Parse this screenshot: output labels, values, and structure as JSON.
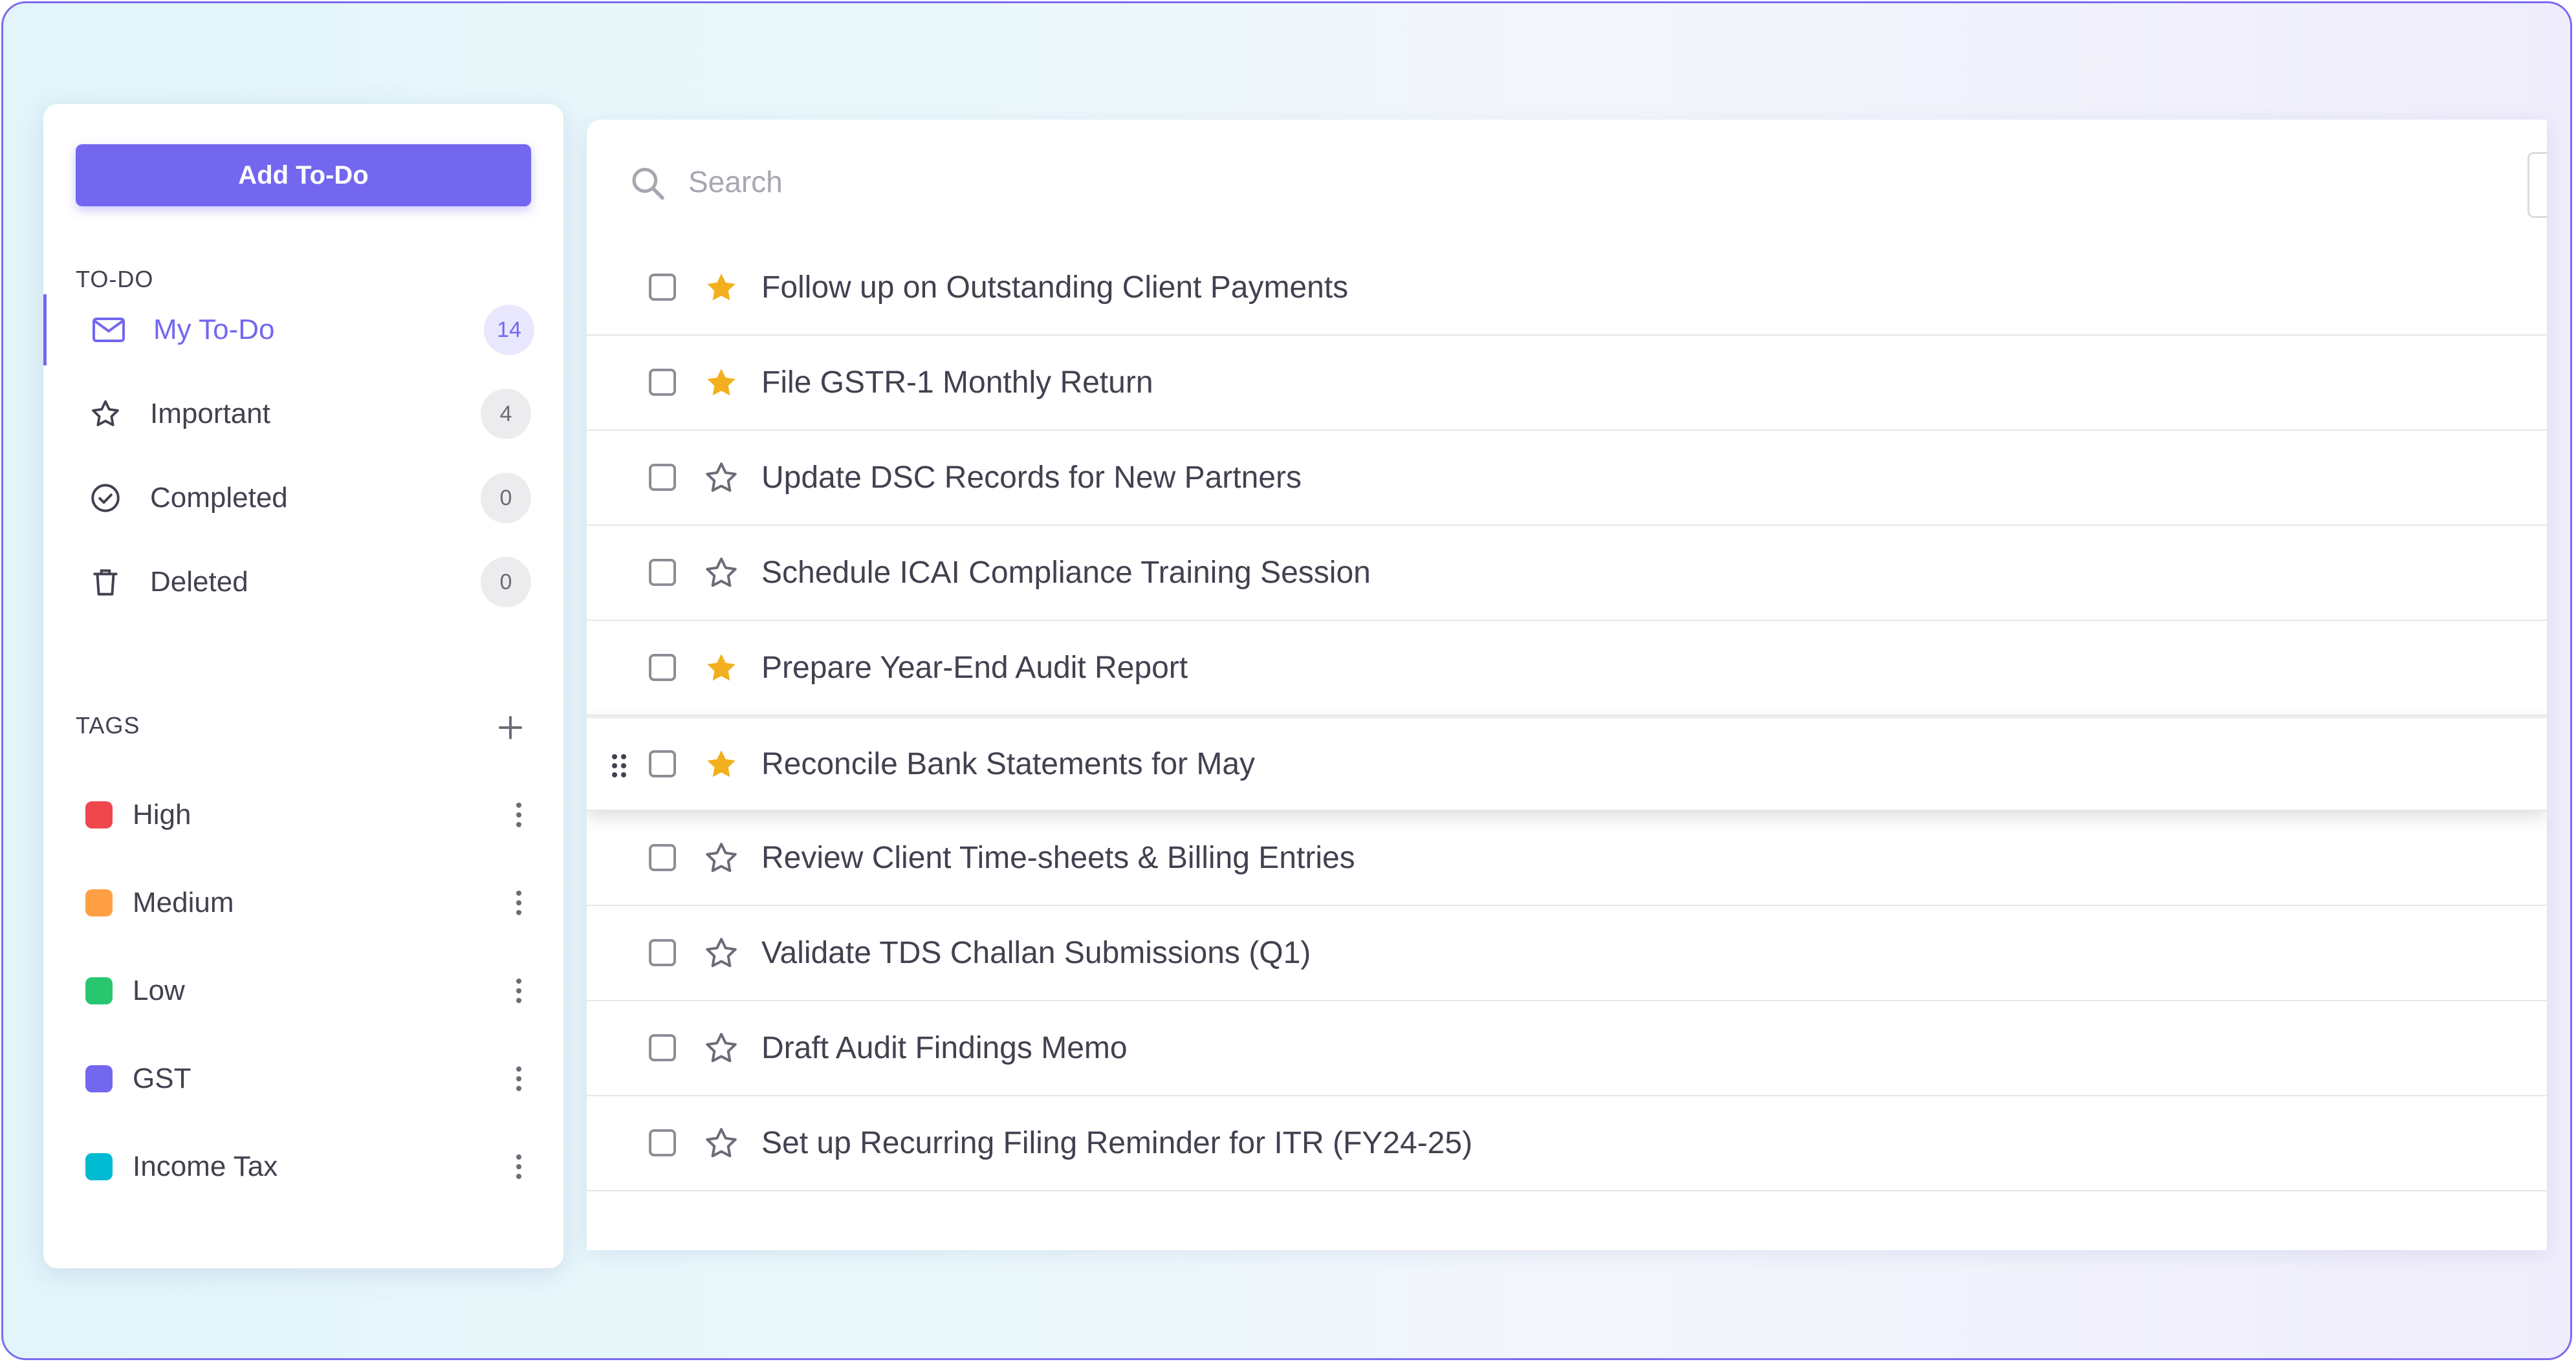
{
  "sidebar": {
    "add_button": "Add To-Do",
    "todo_section_title": "TO-DO",
    "nav": [
      {
        "label": "My To-Do",
        "count": "14",
        "icon": "mail-icon",
        "active": true
      },
      {
        "label": "Important",
        "count": "4",
        "icon": "star-outline-icon",
        "active": false
      },
      {
        "label": "Completed",
        "count": "0",
        "icon": "check-circle-icon",
        "active": false
      },
      {
        "label": "Deleted",
        "count": "0",
        "icon": "trash-icon",
        "active": false
      }
    ],
    "tags_section_title": "TAGS",
    "tags": [
      {
        "label": "High",
        "color": "#f0474f"
      },
      {
        "label": "Medium",
        "color": "#ff9f43"
      },
      {
        "label": "Low",
        "color": "#28c76f"
      },
      {
        "label": "GST",
        "color": "#7367f0"
      },
      {
        "label": "Income Tax",
        "color": "#00bad1"
      }
    ]
  },
  "search": {
    "placeholder": "Search",
    "value": ""
  },
  "todos": [
    {
      "title": "Follow up on Outstanding Client Payments",
      "starred": true
    },
    {
      "title": "File GSTR-1 Monthly Return",
      "starred": true
    },
    {
      "title": "Update DSC Records for New Partners",
      "starred": false
    },
    {
      "title": "Schedule ICAI Compliance Training Session",
      "starred": false
    },
    {
      "title": "Prepare Year-End Audit Report",
      "starred": true
    },
    {
      "title": "Reconcile Bank Statements for May",
      "starred": true,
      "dragging": true
    },
    {
      "title": "Review Client Time-sheets & Billing Entries",
      "starred": false
    },
    {
      "title": "Validate TDS Challan Submissions (Q1)",
      "starred": false
    },
    {
      "title": "Draft Audit Findings Memo",
      "starred": false
    },
    {
      "title": "Set up Recurring Filing Reminder for ITR (FY24-25)",
      "starred": false
    }
  ],
  "colors": {
    "accent": "#7367f0",
    "star": "#f2b01e",
    "text": "#444050"
  }
}
